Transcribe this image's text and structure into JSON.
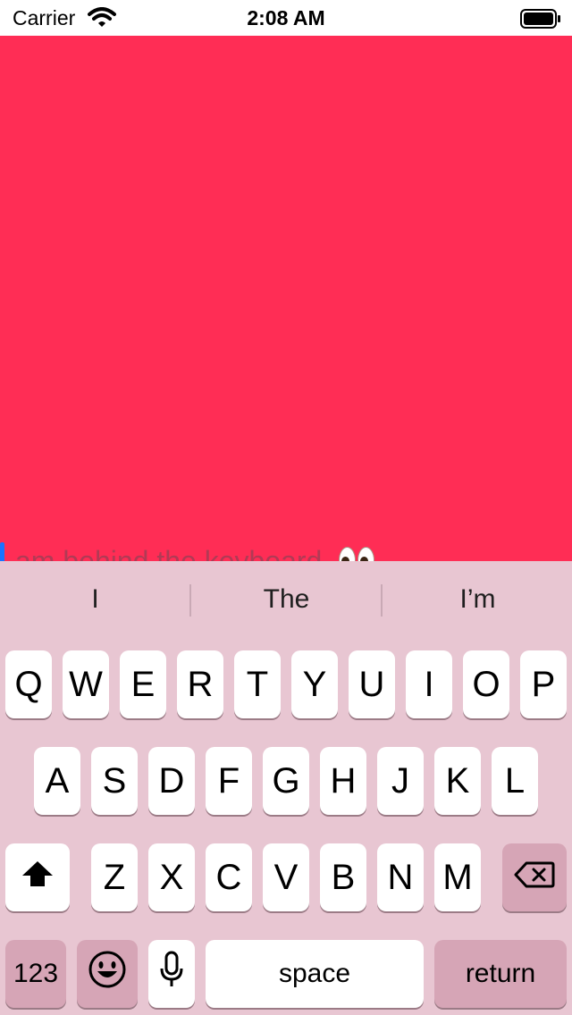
{
  "status_bar": {
    "carrier": "Carrier",
    "time": "2:08 AM"
  },
  "text_field": {
    "text": "am behind the keyboard",
    "emoji_name": "eyes-emoji"
  },
  "keyboard": {
    "suggestions": [
      "I",
      "The",
      "I’m"
    ],
    "rows": [
      [
        "Q",
        "W",
        "E",
        "R",
        "T",
        "Y",
        "U",
        "I",
        "O",
        "P"
      ],
      [
        "A",
        "S",
        "D",
        "F",
        "G",
        "H",
        "J",
        "K",
        "L"
      ],
      [
        "Z",
        "X",
        "C",
        "V",
        "B",
        "N",
        "M"
      ]
    ],
    "numbers_label": "123",
    "space_label": "space",
    "return_label": "return"
  },
  "colors": {
    "content_bg": "#ff2d55",
    "keyboard_bg": "#e8c6d2",
    "cursor": "#1a73ff"
  }
}
